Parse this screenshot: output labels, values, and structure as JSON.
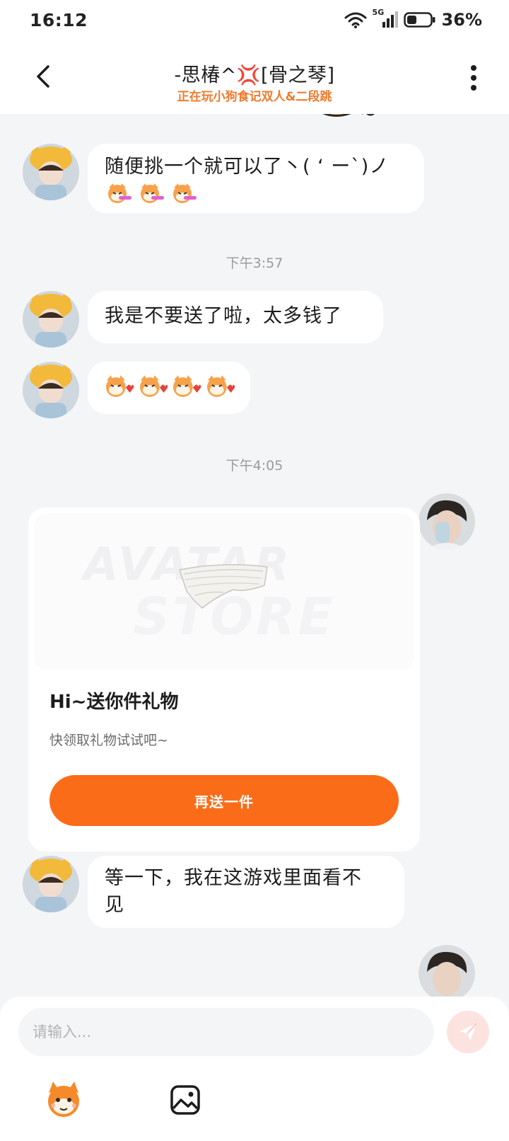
{
  "status_bar": {
    "time": "16:12",
    "network": "5G",
    "battery": "36%"
  },
  "header": {
    "title": "-思椿^💢[骨之琴]",
    "subtitle": "正在玩小狗食记双人&二段跳"
  },
  "messages": [
    {
      "type": "text",
      "side": "left",
      "text": "随便挑一个就可以了丶( ‘ ー`)ノ"
    },
    {
      "type": "time",
      "text": "下午3:57"
    },
    {
      "type": "text",
      "side": "left",
      "text": "我是不要送了啦，太多钱了"
    },
    {
      "type": "sticker",
      "side": "left"
    },
    {
      "type": "time",
      "text": "下午4:05"
    },
    {
      "type": "gift",
      "side": "right",
      "title": "Hi~送你件礼物",
      "desc": "快领取礼物试试吧~",
      "button": "再送一件",
      "watermark_top": "AVATAR",
      "watermark_bottom": "STORE"
    },
    {
      "type": "text",
      "side": "left",
      "line1": "等一下，我在这游戏里面看不",
      "line2": "见"
    }
  ],
  "input": {
    "placeholder": "请输入..."
  },
  "toolbar": {
    "sticker_icon": "mascot-sticker-icon",
    "image_icon": "image-icon"
  },
  "colors": {
    "accent": "#fb6c18",
    "subtitle": "#f07a2e",
    "background": "#f4f5f7"
  }
}
